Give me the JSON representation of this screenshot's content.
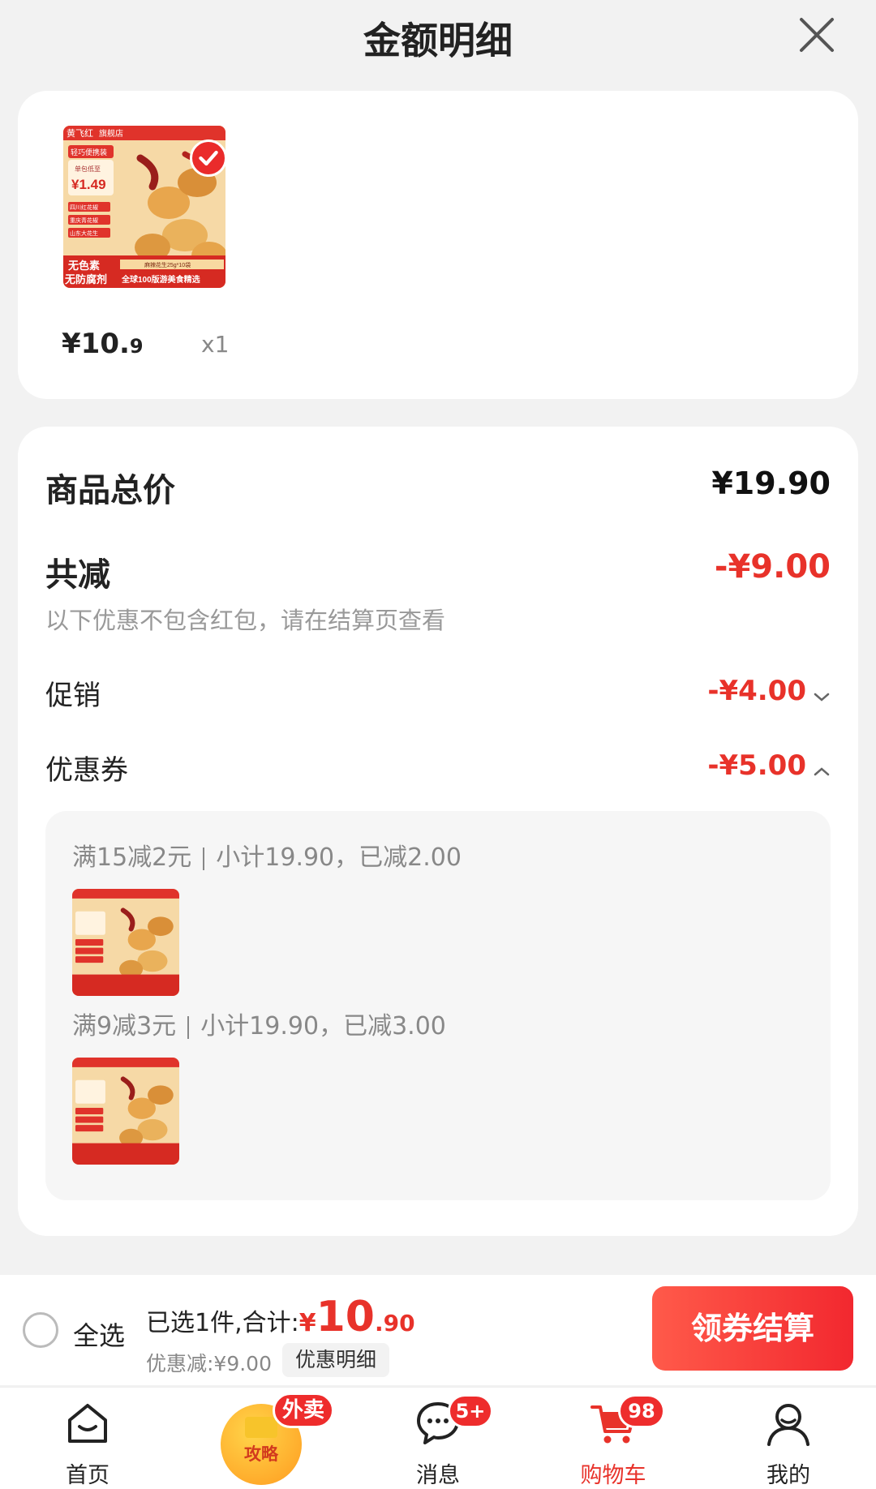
{
  "header": {
    "title": "金额明细"
  },
  "product": {
    "store_name": "黄飞红",
    "store_tag": "旗舰店",
    "img_tag": "轻巧便携装",
    "img_sub": "单包低至",
    "img_price": "¥1.49",
    "img_features": [
      "四川红花椒",
      "重庆青花椒",
      "山东大花生"
    ],
    "img_banner1": "无色素",
    "img_banner2": "无防腐剂",
    "img_spec": "麻辣花生25g*10袋",
    "img_slogan": "全球100版游美食精选",
    "price_int": "¥10.",
    "price_dec": "9",
    "qty": "x1"
  },
  "summary": {
    "total_label": "商品总价",
    "total_value": "¥19.90",
    "discount_label": "共减",
    "discount_value": "-¥9.00",
    "note": "以下优惠不包含红包，请在结算页查看",
    "promo_label": "促销",
    "promo_value": "-¥4.00",
    "coupon_label": "优惠券",
    "coupon_value": "-¥5.00",
    "coupons": [
      {
        "rule": "满15减2元",
        "detail": "小计19.90，已减2.00"
      },
      {
        "rule": "满9减3元",
        "detail": "小计19.90，已减3.00"
      }
    ]
  },
  "checkout": {
    "select_all": "全选",
    "selected_text": "已选1件,合计:",
    "currency": "¥",
    "total_int": "10",
    "total_dec": ".90",
    "saved": "优惠减:¥9.00",
    "detail_btn": "优惠明细",
    "checkout_btn": "领券结算"
  },
  "tabbar": {
    "home": "首页",
    "promo_badge": "外卖",
    "promo_text": "攻略",
    "messages": "消息",
    "messages_badge": "5+",
    "cart": "购物车",
    "cart_badge": "98",
    "me": "我的"
  },
  "colors": {
    "accent": "#e8322a",
    "background": "#f2f2f2"
  }
}
